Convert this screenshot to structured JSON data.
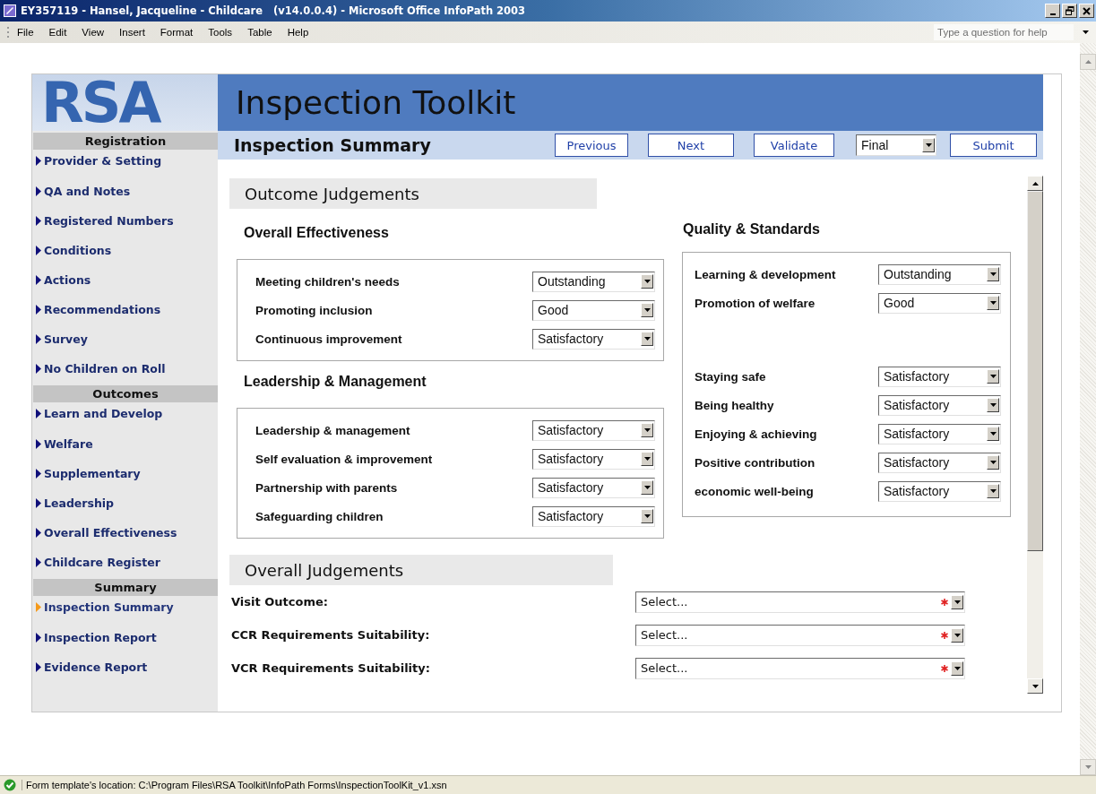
{
  "window": {
    "title": "EY357119 - Hansel, Jacqueline - Childcare   (v14.0.0.4) - Microsoft Office InfoPath 2003"
  },
  "menu": {
    "items": [
      "File",
      "Edit",
      "View",
      "Insert",
      "Format",
      "Tools",
      "Table",
      "Help"
    ],
    "help_box": {
      "placeholder": "Type a question for help"
    }
  },
  "logo": {
    "text": "RSA"
  },
  "header": {
    "title": "Inspection Toolkit"
  },
  "sidebar": {
    "sections": [
      {
        "heading": "Registration",
        "items": [
          {
            "label": "Provider & Setting",
            "selected": false
          },
          {
            "label": "QA and Notes",
            "selected": false
          },
          {
            "label": "Registered Numbers",
            "selected": false
          },
          {
            "label": "Conditions",
            "selected": false
          },
          {
            "label": "Actions",
            "selected": false
          },
          {
            "label": "Recommendations",
            "selected": false
          },
          {
            "label": "Survey",
            "selected": false
          },
          {
            "label": "No Children on Roll",
            "selected": false
          }
        ]
      },
      {
        "heading": "Outcomes",
        "items": [
          {
            "label": "Learn and Develop",
            "selected": false
          },
          {
            "label": "Welfare",
            "selected": false
          },
          {
            "label": "Supplementary",
            "selected": false
          },
          {
            "label": "Leadership",
            "selected": false
          },
          {
            "label": "Overall Effectiveness",
            "selected": false
          },
          {
            "label": "Childcare Register",
            "selected": false
          }
        ]
      },
      {
        "heading": "Summary",
        "items": [
          {
            "label": "Inspection Summary",
            "selected": true
          },
          {
            "label": "Inspection Report",
            "selected": false
          },
          {
            "label": "Evidence Report",
            "selected": false
          }
        ]
      }
    ]
  },
  "toolbar": {
    "page_title": "Inspection Summary",
    "controls": [
      {
        "kind": "button",
        "label": "Previous"
      },
      {
        "kind": "button",
        "label": "Next"
      },
      {
        "kind": "button",
        "label": "Validate"
      },
      {
        "kind": "dropdown",
        "label": "Final"
      },
      {
        "kind": "button",
        "label": "Submit"
      }
    ]
  },
  "outcome_judgements": {
    "heading": "Outcome Judgements",
    "columns": [
      [
        {
          "title": "Overall Effectiveness",
          "blocks": [
            [
              {
                "label": "Meeting children's needs",
                "value": "Outstanding"
              },
              {
                "label": "Promoting inclusion",
                "value": "Good"
              },
              {
                "label": "Continuous improvement",
                "value": "Satisfactory"
              }
            ]
          ]
        },
        {
          "title": "Leadership & Management",
          "blocks": [
            [
              {
                "label": "Leadership & management",
                "value": "Satisfactory"
              },
              {
                "label": "Self evaluation & improvement",
                "value": "Satisfactory"
              },
              {
                "label": "Partnership with parents",
                "value": "Satisfactory"
              },
              {
                "label": "Safeguarding children",
                "value": "Satisfactory"
              }
            ]
          ]
        }
      ],
      [
        {
          "title": "Quality & Standards",
          "blocks": [
            [
              {
                "label": "Learning & development",
                "value": "Outstanding"
              },
              {
                "label": "Promotion of welfare",
                "value": "Good"
              }
            ],
            [
              {
                "label": "Staying safe",
                "value": "Satisfactory"
              },
              {
                "label": "Being healthy",
                "value": "Satisfactory"
              },
              {
                "label": "Enjoying & achieving",
                "value": "Satisfactory"
              },
              {
                "label": "Positive contribution",
                "value": "Satisfactory"
              },
              {
                "label": "economic well-being",
                "value": "Satisfactory"
              }
            ]
          ]
        }
      ]
    ]
  },
  "overall_judgements": {
    "heading": "Overall Judgements",
    "rows": [
      {
        "label": "Visit Outcome:",
        "value": "Select...",
        "required": true
      },
      {
        "label": "CCR Requirements Suitability:",
        "value": "Select...",
        "required": true
      },
      {
        "label": "VCR Requirements Suitability:",
        "value": "Select...",
        "required": true
      }
    ]
  },
  "status_bar": {
    "text": "Form template's location: C:\\Program Files\\RSA Toolkit\\InfoPath Forms\\InspectionToolKit_v1.xsn"
  }
}
